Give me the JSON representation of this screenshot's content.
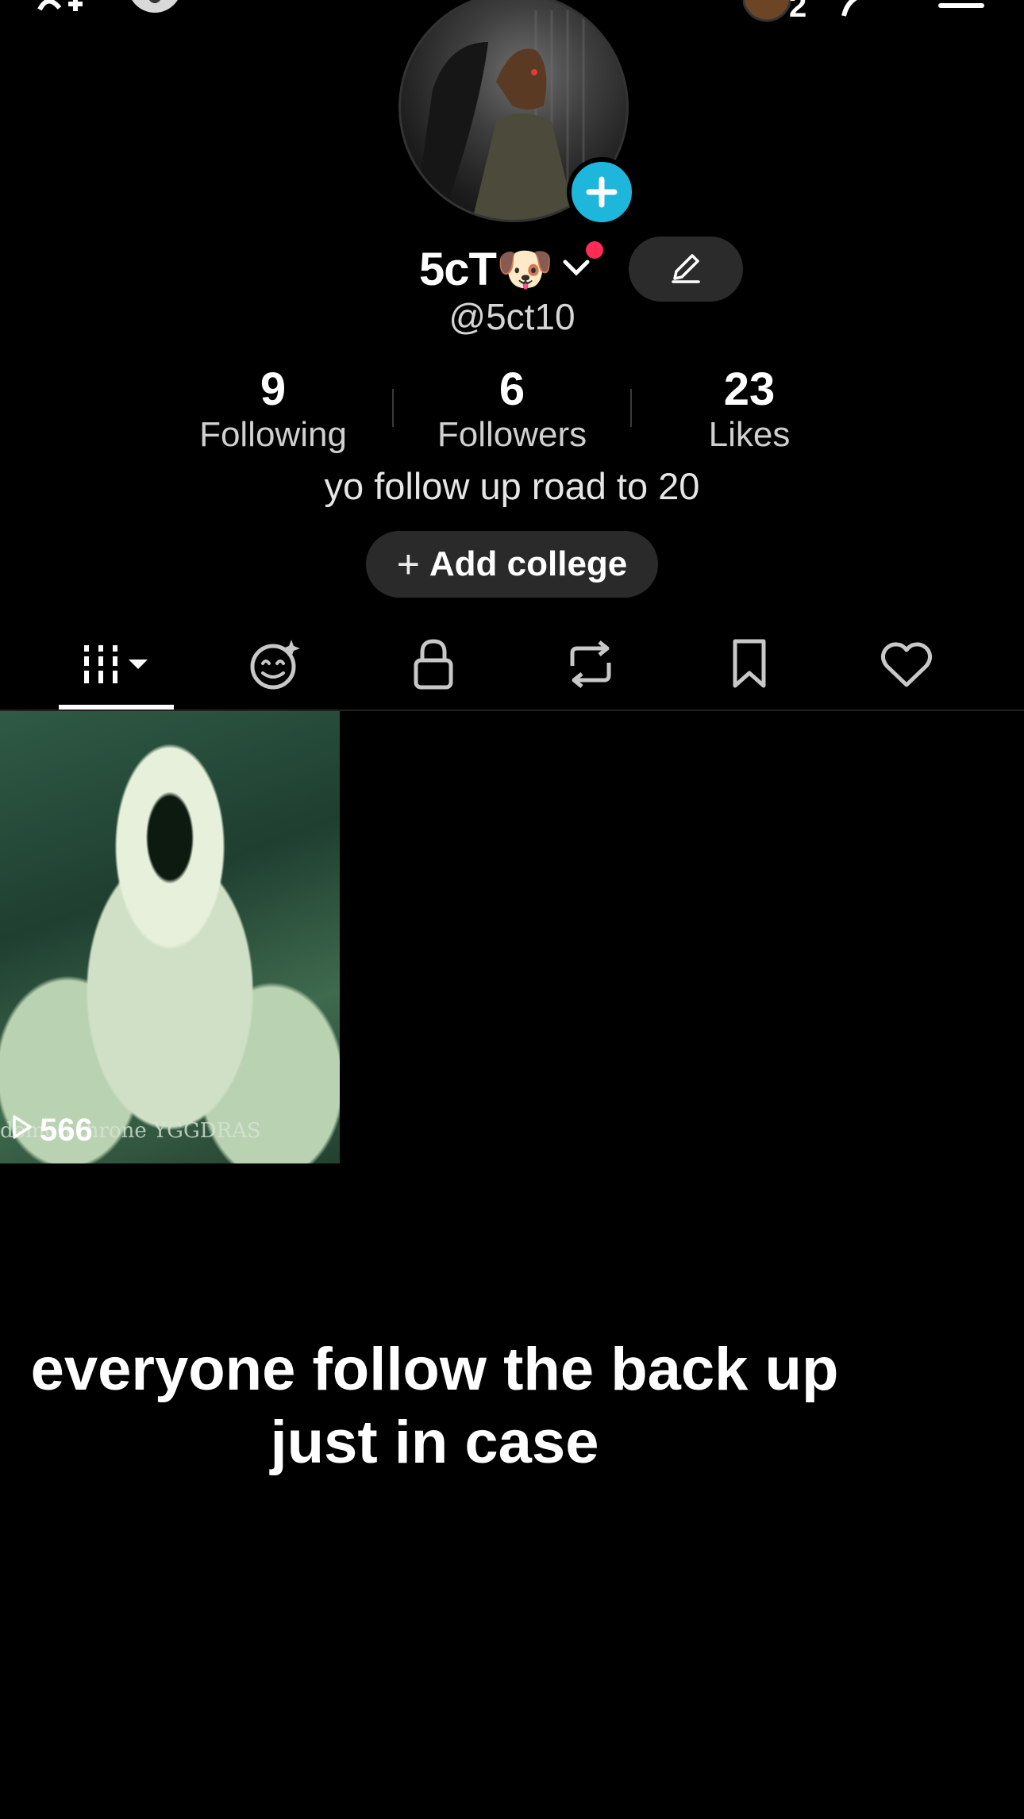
{
  "profile": {
    "display_name": "5cT🐶",
    "handle": "@5ct10",
    "bio": "yo follow up road to 20"
  },
  "header": {
    "notification_count": "2"
  },
  "stats": [
    {
      "value": "9",
      "label": "Following"
    },
    {
      "value": "6",
      "label": "Followers"
    },
    {
      "value": "23",
      "label": "Likes"
    }
  ],
  "buttons": {
    "add_college_plus": "+",
    "add_college": "Add college"
  },
  "tabs": [
    {
      "icon": "grid-icon"
    },
    {
      "icon": "reposted-face-icon"
    },
    {
      "icon": "lock-icon"
    },
    {
      "icon": "repost-icon"
    },
    {
      "icon": "bookmark-icon"
    },
    {
      "icon": "heart-icon"
    }
  ],
  "videos": [
    {
      "views": "566",
      "overlay_text": "demon throne YGGDRAS"
    }
  ],
  "caption": "everyone follow the back up just in case",
  "colors": {
    "accent_blue": "#1fb6dc",
    "notification_red": "#fe2c55",
    "background": "#000000"
  }
}
